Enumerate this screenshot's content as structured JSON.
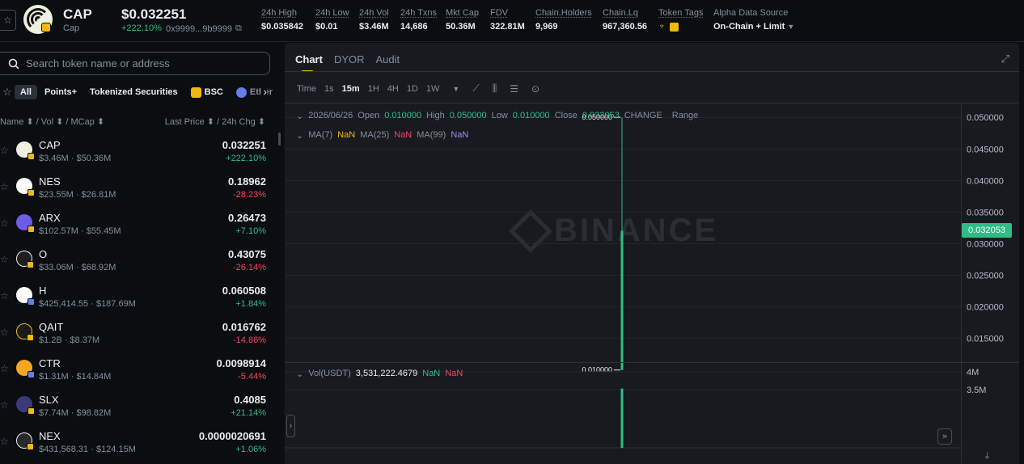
{
  "header": {
    "symbol": "CAP",
    "name": "Cap",
    "price": "$0.032251",
    "change": "+222.10%",
    "address": "0x9999...9b9999",
    "stats": [
      {
        "label": "24h High",
        "value": "$0.035842"
      },
      {
        "label": "24h Low",
        "value": "$0.01"
      },
      {
        "label": "24h Vol",
        "value": "$3.46M"
      },
      {
        "label": "24h Txns",
        "value": "14,686"
      },
      {
        "label": "Mkt Cap",
        "value": "50.36M"
      },
      {
        "label": "FDV",
        "value": "322.81M"
      },
      {
        "label": "Chain.Holders",
        "value": "9,969"
      },
      {
        "label": "Chain.Lq",
        "value": "967,360.56"
      }
    ],
    "token_tags_label": "Token Tags",
    "alpha_label": "Alpha Data Source",
    "alpha_value": "On-Chain + Limit"
  },
  "search": {
    "placeholder": "Search token name or address"
  },
  "filters": {
    "items": [
      "All",
      "Points+",
      "Tokenized Securities",
      "BSC",
      "Ether"
    ],
    "active": "All"
  },
  "columns": {
    "left": "Name ⬍ / Vol ⬍ / MCap ⬍",
    "right": "Last Price ⬍ / 24h Chg ⬍"
  },
  "tokens": [
    {
      "symbol": "CAP",
      "sub": "$3.46M · $50.36M",
      "price": "0.032251",
      "change": "+222.10%",
      "dir": "up",
      "color": "#f0f0e0"
    },
    {
      "symbol": "NES",
      "sub": "$23.55M · $26.81M",
      "price": "0.18962",
      "change": "-28.23%",
      "dir": "down",
      "color": "#ffffff"
    },
    {
      "symbol": "ARX",
      "sub": "$102.57M · $55.45M",
      "price": "0.26473",
      "change": "+7.10%",
      "dir": "up",
      "color": "#6c5ce7"
    },
    {
      "symbol": "O",
      "sub": "$33.06M · $68.92M",
      "price": "0.43075",
      "change": "-26.14%",
      "dir": "down",
      "color": "#1e1e1e"
    },
    {
      "symbol": "H",
      "sub": "$425,414.55 · $187.69M",
      "price": "0.060508",
      "change": "+1.84%",
      "dir": "up",
      "color": "#ffffff"
    },
    {
      "symbol": "QAIT",
      "sub": "$1.2B · $8.37M",
      "price": "0.016762",
      "change": "-14.86%",
      "dir": "down",
      "color": "#1a1a1a"
    },
    {
      "symbol": "CTR",
      "sub": "$1.31M · $14.84M",
      "price": "0.0098914",
      "change": "-5.44%",
      "dir": "down",
      "color": "#f5a623"
    },
    {
      "symbol": "SLX",
      "sub": "$7.74M · $98.82M",
      "price": "0.4085",
      "change": "+21.14%",
      "dir": "up",
      "color": "#3a3a7a"
    },
    {
      "symbol": "NEX",
      "sub": "$431,568.31 · $124.15M",
      "price": "0.0000020691",
      "change": "+1.06%",
      "dir": "up",
      "color": "#2a2a2a"
    }
  ],
  "chart": {
    "tabs": [
      "Chart",
      "DYOR",
      "Audit"
    ],
    "active_tab": "Chart",
    "time_label": "Time",
    "timeframes": [
      "1s",
      "15m",
      "1H",
      "4H",
      "1D",
      "1W"
    ],
    "active_timeframe": "15m",
    "date": "2026/06/26",
    "open_label": "Open",
    "open": "0.010000",
    "high_label": "High",
    "high": "0.050000",
    "low_label": "Low",
    "low": "0.010000",
    "close_label": "Close",
    "close": "0.032053",
    "change_label": "CHANGE",
    "range_label": "Range",
    "ma7_label": "MA(7)",
    "ma7": "NaN",
    "ma25_label": "MA(25)",
    "ma25": "NaN",
    "ma99_label": "MA(99)",
    "ma99": "NaN",
    "vol_label": "Vol(USDT)",
    "vol_value": "3,531,222.4679",
    "vol_ma1": "NaN",
    "vol_ma2": "NaN",
    "watermark": "BINANCE",
    "price_tag": "0.032053",
    "high_marker": "0.050000",
    "low_marker": "0.010000",
    "y_ticks": [
      "0.050000",
      "0.045000",
      "0.040000",
      "0.035000",
      "0.030000",
      "0.025000",
      "0.020000",
      "0.015000"
    ],
    "vol_ticks": [
      "4M",
      "3.5M"
    ],
    "colors": {
      "up": "#2ebd85",
      "down": "#f6465d",
      "accent": "#f0b90b",
      "ma7": "#f0b90b",
      "ma25": "#f6465d",
      "ma99": "#9c8cff"
    }
  },
  "chart_data": {
    "type": "bar",
    "candle": {
      "date": "2026/06/26",
      "open": 0.01,
      "high": 0.05,
      "low": 0.01,
      "close": 0.032053
    },
    "y_range": [
      0.0115,
      0.0522
    ],
    "volume": 3531222.4679,
    "vol_range": [
      3000000,
      4000000
    ]
  }
}
